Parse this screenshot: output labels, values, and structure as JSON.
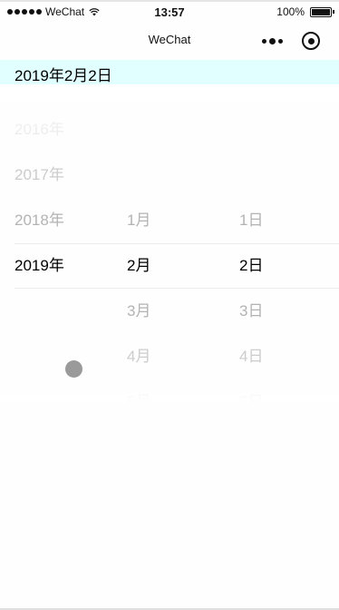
{
  "status_bar": {
    "carrier": "WeChat",
    "time": "13:57",
    "battery_percent": "100%",
    "battery_level": 1.0,
    "icons": [
      "signal-dots-icon",
      "wifi-icon",
      "battery-icon"
    ]
  },
  "nav_bar": {
    "title": "WeChat",
    "icons": [
      "more-icon",
      "close-icon"
    ]
  },
  "selected_date": "2019年2月2日",
  "picker": {
    "years": [
      "2016年",
      "2017年",
      "2018年",
      "2019年"
    ],
    "months": [
      "1月",
      "2月",
      "3月",
      "4月",
      "5月"
    ],
    "days": [
      "1日",
      "2日",
      "3日",
      "4日",
      "5日"
    ],
    "selected": {
      "year": "2019年",
      "month": "2月",
      "day": "2日"
    }
  },
  "colors": {
    "banner_background": "#e0fffe",
    "selected_text": "#000000",
    "unselected_text": "#b3b3b3",
    "indicator_line": "#ececec",
    "touch_indicator": "#9a9a9a"
  }
}
